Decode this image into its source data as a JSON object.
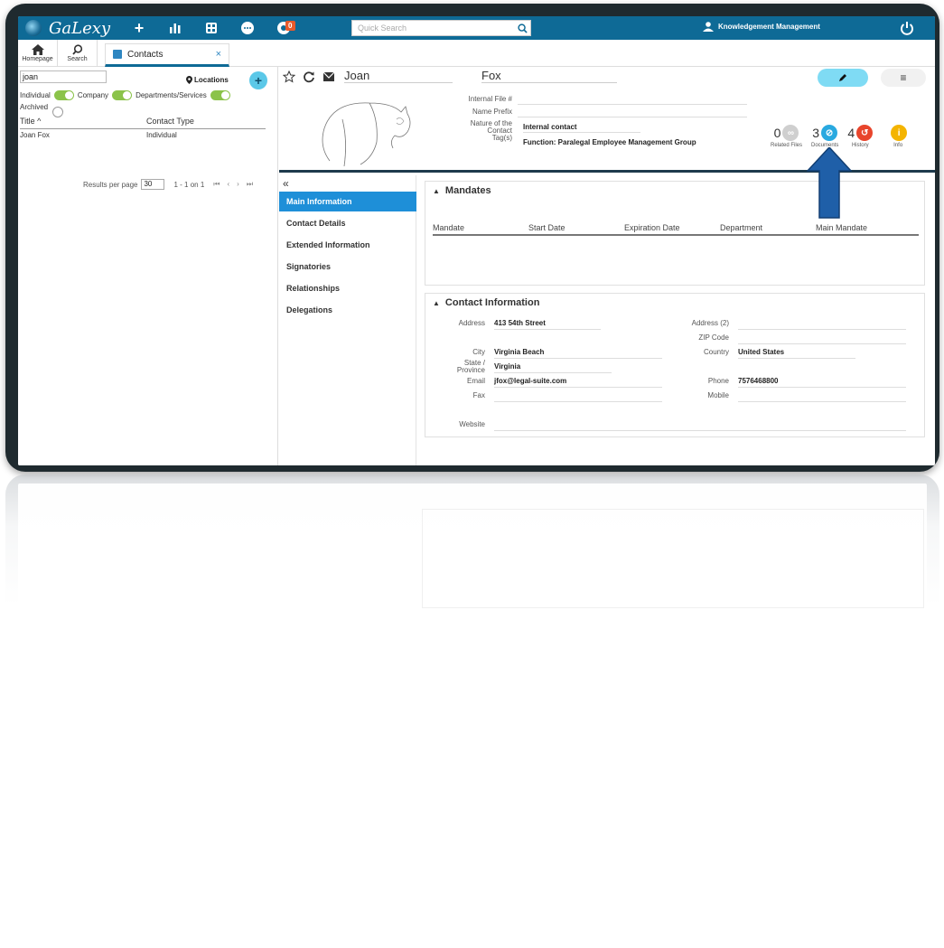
{
  "app": {
    "name": "GaLexy"
  },
  "topbar": {
    "quick_search_placeholder": "Quick Search",
    "notification_count": "0",
    "user_name": "Knowledgement Management"
  },
  "nav": {
    "homepage": "Homepage",
    "search": "Search"
  },
  "tab": {
    "label": "Contacts"
  },
  "left_panel": {
    "search_value": "joan",
    "locations_label": "Locations",
    "filters": [
      "Individual",
      "Company",
      "Departments/Services"
    ],
    "archived_label": "Archived",
    "columns": [
      "Title",
      "Contact Type"
    ],
    "rows": [
      {
        "title": "Joan Fox",
        "type": "Individual"
      }
    ],
    "pager": {
      "label": "Results per page",
      "per_page": "30",
      "range": "1 - 1 on 1"
    }
  },
  "contact": {
    "first_name": "Joan",
    "last_name": "Fox",
    "fields": {
      "internal_file_label": "Internal File #",
      "name_prefix_label": "Name Prefix",
      "nature_label_1": "Nature of the",
      "nature_label_2": "Contact",
      "nature_value": "Internal contact",
      "tags_label": "Tag(s)",
      "tags_value": "Function: Paralegal   Employee Management Group"
    },
    "stats": [
      {
        "count": "0",
        "label": "Related Files",
        "color": "#cfcfcf"
      },
      {
        "count": "3",
        "label": "Documents",
        "color": "#29a9e0"
      },
      {
        "count": "4",
        "label": "History",
        "color": "#e8452c"
      },
      {
        "count": "",
        "label": "Info",
        "color": "#f4b400"
      }
    ]
  },
  "sidenav": {
    "items": [
      "Main Information",
      "Contact Details",
      "Extended Information",
      "Signatories",
      "Relationships",
      "Delegations"
    ]
  },
  "mandates": {
    "title": "Mandates",
    "columns": [
      "Mandate",
      "Start Date",
      "Expiration Date",
      "Department",
      "Main Mandate"
    ]
  },
  "contact_info": {
    "title": "Contact Information",
    "labels": {
      "address": "Address",
      "address2": "Address (2)",
      "zip": "ZIP Code",
      "city": "City",
      "country": "Country",
      "state1": "State /",
      "state2": "Province",
      "email": "Email",
      "phone": "Phone",
      "fax": "Fax",
      "mobile": "Mobile",
      "website": "Website"
    },
    "values": {
      "address": "413 54th Street",
      "city": "Virginia Beach",
      "country": "United States",
      "state": "Virginia",
      "email": "jfox@legal-suite.com",
      "phone": "7576468800"
    }
  },
  "colors": {
    "topbar": "#0e6a96",
    "active_nav": "#1e8fd8",
    "arrow": "#1f5fa8",
    "toggle": "#8bc34a"
  }
}
